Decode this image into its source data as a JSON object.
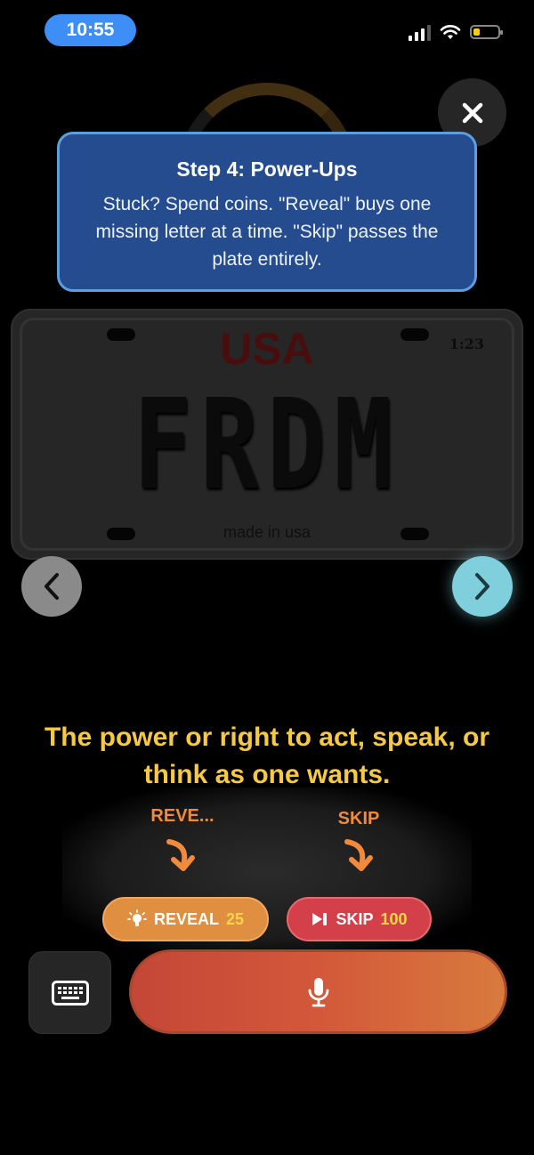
{
  "status_bar": {
    "time": "10:55",
    "battery_color": "#f5cc1c"
  },
  "tutorial": {
    "title": "Step 4: Power-Ups",
    "body": "Stuck? Spend coins. \"Reveal\" buys one missing letter at a time. \"Skip\" passes the plate entirely."
  },
  "plate": {
    "country": "USA",
    "timer": "1:23",
    "text": "FRDM",
    "footer": "made in usa"
  },
  "definition": "The power or right to act, speak, or think as one wants.",
  "hints": {
    "reveal_label": "REVE...",
    "skip_label": "SKIP"
  },
  "powerups": {
    "reveal": {
      "label": "REVEAL",
      "cost": "25",
      "icon": "lightbulb-icon"
    },
    "skip": {
      "label": "SKIP",
      "cost": "100",
      "icon": "skip-forward-icon"
    }
  },
  "controls": {
    "keyboard_icon": "keyboard-icon",
    "mic_icon": "microphone-icon"
  },
  "colors": {
    "accent_yellow": "#f6c945",
    "reveal_orange": "#e08e3f",
    "skip_red": "#d3404a",
    "callout_blue": "#254c8e"
  }
}
